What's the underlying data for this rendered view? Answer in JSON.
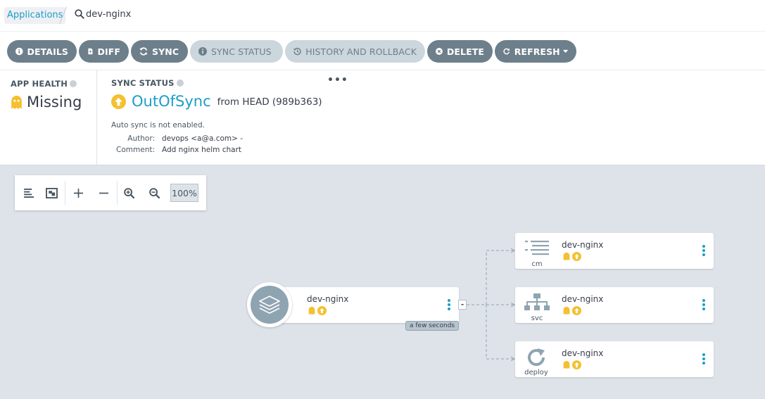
{
  "breadcrumb": {
    "root": "Applications",
    "current": "dev-nginx"
  },
  "toolbar": {
    "details": "DETAILS",
    "diff": "DIFF",
    "sync": "SYNC",
    "sync_status": "SYNC STATUS",
    "history": "HISTORY AND ROLLBACK",
    "delete": "DELETE",
    "refresh": "REFRESH"
  },
  "health": {
    "label": "APP HEALTH",
    "value": "Missing"
  },
  "sync": {
    "label": "SYNC STATUS",
    "state": "OutOfSync",
    "from": "from HEAD (989b363)",
    "auto_sync": "Auto sync is not enabled.",
    "author_key": "Author:",
    "author_val": "devops <a@a.com> -",
    "comment_key": "Comment:",
    "comment_val": "Add nginx helm chart"
  },
  "graph": {
    "zoom": "100%",
    "app_node": {
      "name": "dev-nginx",
      "age": "a few seconds"
    },
    "resources": [
      {
        "name": "dev-nginx",
        "kind": "cm"
      },
      {
        "name": "dev-nginx",
        "kind": "svc"
      },
      {
        "name": "dev-nginx",
        "kind": "deploy"
      }
    ]
  },
  "colors": {
    "accent": "#1e9dc8",
    "button": "#6d7f8b",
    "button_disabled": "#ccd6dd",
    "missing_yellow": "#f4c030",
    "outofsync_yellow": "#f4c030",
    "graph_bg": "#dee3e9"
  }
}
